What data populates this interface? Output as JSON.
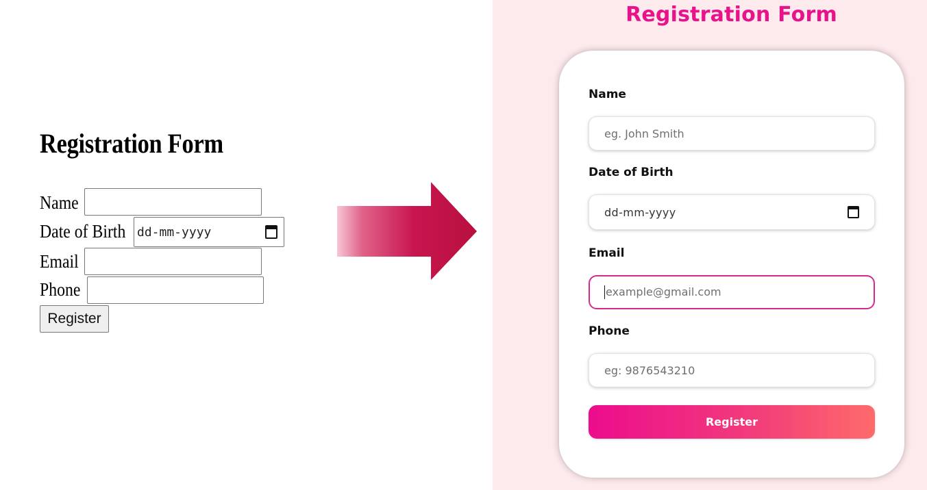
{
  "plain_form": {
    "title": "Registration Form",
    "fields": [
      {
        "label": "Name",
        "value": ""
      },
      {
        "label": "Date of Birth",
        "value": "dd-mm-yyyy"
      },
      {
        "label": "Email",
        "value": ""
      },
      {
        "label": "Phone",
        "value": ""
      }
    ],
    "button_label": "Register"
  },
  "arrow": {
    "icon": "right-arrow-icon",
    "color": "#c8154f"
  },
  "styled_form": {
    "title": "Registration Form",
    "accent_color": "#e8138a",
    "panel_background": "#fdeaec",
    "fields": [
      {
        "label": "Name",
        "placeholder": "eg. John Smith"
      },
      {
        "label": "Date of Birth",
        "value": "dd-mm-yyyy"
      },
      {
        "label": "Email",
        "placeholder": "example@gmail.com",
        "focused": true
      },
      {
        "label": "Phone",
        "placeholder": "eg: 9876543210"
      }
    ],
    "button_label": "Register",
    "button_gradient": [
      "#ec0c8c",
      "#fe6a6a"
    ]
  }
}
